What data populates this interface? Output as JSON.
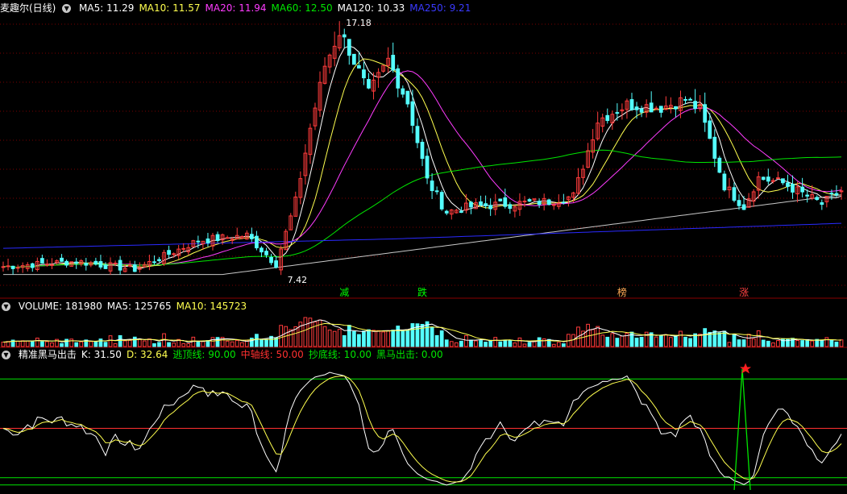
{
  "colors": {
    "bg": "#000000",
    "grid": "#7a0000",
    "up": "#ff3c3c",
    "down": "#54ffff",
    "ma5": "#ffffff",
    "ma10": "#ffff4f",
    "ma20": "#ff3cff",
    "ma60": "#00e600",
    "ma120": "#c8c8c8",
    "ma250": "#2a2aff",
    "k": "#ffffff",
    "d": "#ffff4f",
    "line_top": "#00e600",
    "line_mid": "#ff3030",
    "line_bottom": "#00e600",
    "signal": "#00e600"
  },
  "price_panel": {
    "name": "麦趣尔(日线)",
    "ma": [
      {
        "label": "MA5: 11.29",
        "color": "#ffffff"
      },
      {
        "label": "MA10: 11.57",
        "color": "#ffff4f"
      },
      {
        "label": "MA20: 11.94",
        "color": "#ff3cff"
      },
      {
        "label": "MA60: 12.50",
        "color": "#00e600"
      },
      {
        "label": "MA120: 10.33",
        "color": "#ffffff"
      },
      {
        "label": "MA250: 9.21",
        "color": "#3a3aff"
      }
    ],
    "high_label": "17.18",
    "low_label": "7.42",
    "annotations": [
      {
        "text": "减",
        "color": "#00ff00",
        "index": 70
      },
      {
        "text": "跌",
        "color": "#00ff00",
        "index": 86
      },
      {
        "text": "榜",
        "color": "#ffaa55",
        "index": 127
      },
      {
        "text": "涨",
        "color": "#ff4040",
        "index": 152
      }
    ]
  },
  "volume_panel": {
    "labels": [
      {
        "text": "VOLUME: 181980",
        "color": "#ffffff"
      },
      {
        "text": "MA5: 125765",
        "color": "#ffffff"
      },
      {
        "text": "MA10: 145723",
        "color": "#ffff4f"
      }
    ]
  },
  "indicator_panel": {
    "labels": [
      {
        "text": "精准黑马出击",
        "color": "#ffffff"
      },
      {
        "text": "K: 31.50",
        "color": "#ffffff"
      },
      {
        "text": "D: 32.64",
        "color": "#ffff4f"
      },
      {
        "text": "逃顶线: 90.00",
        "color": "#00e600"
      },
      {
        "text": "中轴线: 50.00",
        "color": "#ff3030"
      },
      {
        "text": "抄底线: 10.00",
        "color": "#00e600"
      },
      {
        "text": "黑马出击: 0.00",
        "color": "#00e600"
      }
    ],
    "levels": {
      "top": 90,
      "mid": 50,
      "bottom": 10
    },
    "signal_index": 152
  },
  "chart_data": {
    "type": "candlestick",
    "count": 173,
    "anchors_close": [
      [
        0,
        7.9
      ],
      [
        15,
        8.1
      ],
      [
        27,
        7.8
      ],
      [
        33,
        8.3
      ],
      [
        40,
        8.9
      ],
      [
        50,
        9.1
      ],
      [
        56,
        8.0
      ],
      [
        60,
        10.4
      ],
      [
        63,
        13.2
      ],
      [
        66,
        15.6
      ],
      [
        69,
        16.9
      ],
      [
        71,
        16.2
      ],
      [
        75,
        14.5
      ],
      [
        79,
        15.8
      ],
      [
        83,
        14.2
      ],
      [
        87,
        11.2
      ],
      [
        91,
        10.0
      ],
      [
        96,
        10.2
      ],
      [
        104,
        10.3
      ],
      [
        112,
        10.4
      ],
      [
        117,
        10.6
      ],
      [
        122,
        13.5
      ],
      [
        128,
        14.1
      ],
      [
        135,
        14.0
      ],
      [
        140,
        14.3
      ],
      [
        143,
        13.9
      ],
      [
        148,
        11.0
      ],
      [
        152,
        10.2
      ],
      [
        155,
        11.3
      ],
      [
        160,
        11.1
      ],
      [
        168,
        10.3
      ],
      [
        172,
        10.8
      ]
    ],
    "price_range": [
      7.0,
      17.8
    ],
    "volume_range": [
      0,
      230000
    ],
    "indicator_range": [
      0,
      100
    ],
    "series": [
      {
        "name": "MA5",
        "period": 5
      },
      {
        "name": "MA10",
        "period": 10
      },
      {
        "name": "MA20",
        "period": 20
      },
      {
        "name": "MA60",
        "period": 60
      },
      {
        "name": "MA120",
        "period": 120
      },
      {
        "name": "MA250",
        "period": 250
      }
    ]
  }
}
